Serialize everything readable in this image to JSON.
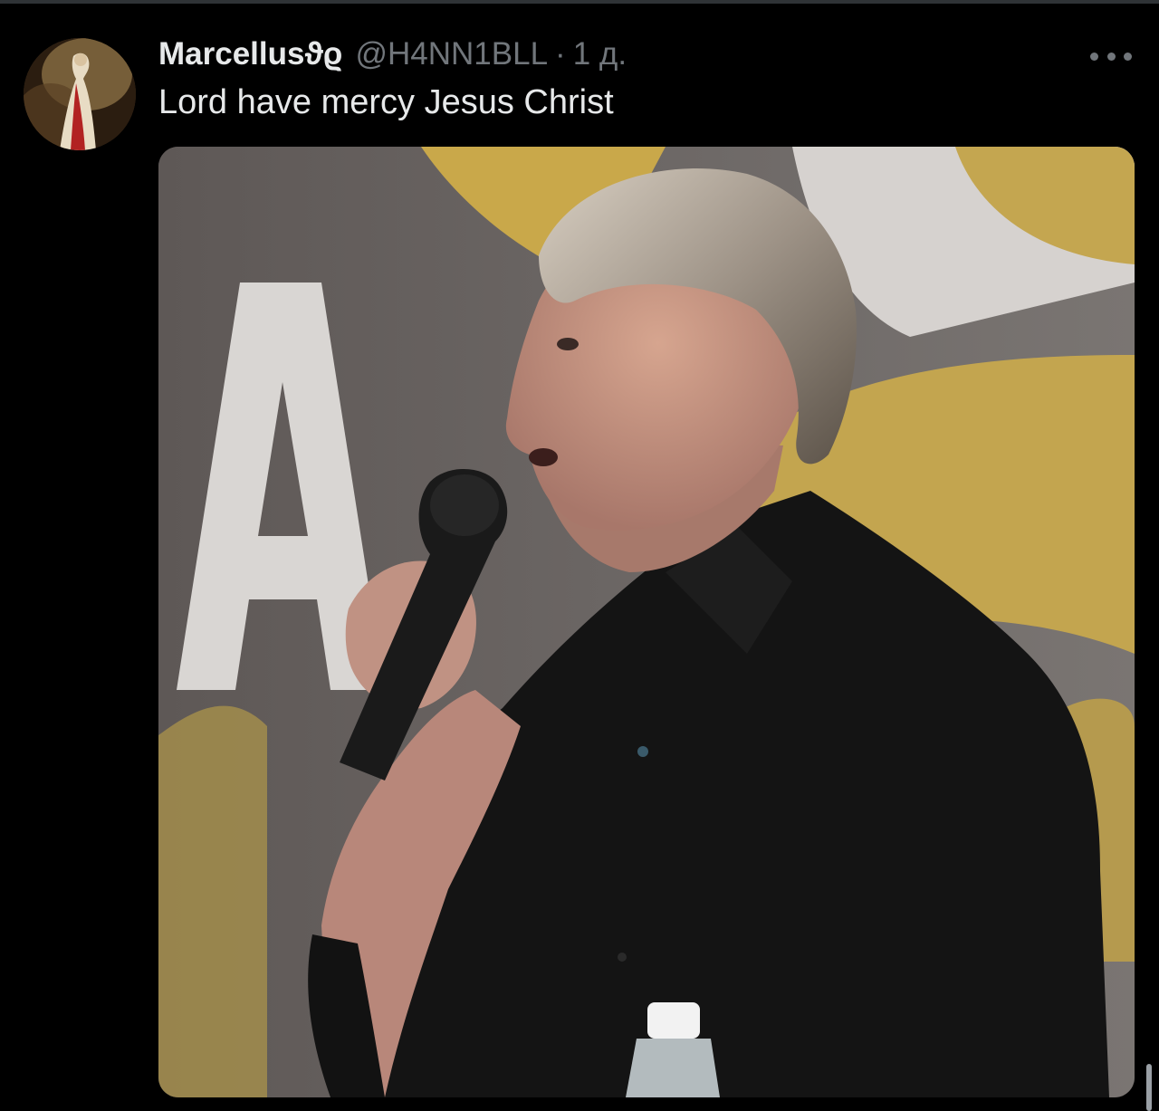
{
  "tweet": {
    "display_name": "Marcellusϑϱ",
    "handle": "@H4NN1BLL",
    "separator": "·",
    "timestamp": "1 д.",
    "text": "Lord have mercy Jesus Christ",
    "more_icon": "more-horizontal-icon",
    "avatar_icon": "profile-avatar-painting",
    "media_description_icon": "tweet-photo"
  },
  "colors": {
    "background": "#000000",
    "primary_text": "#e7e9ea",
    "secondary_text": "#71767b",
    "divider": "#2f3336"
  }
}
